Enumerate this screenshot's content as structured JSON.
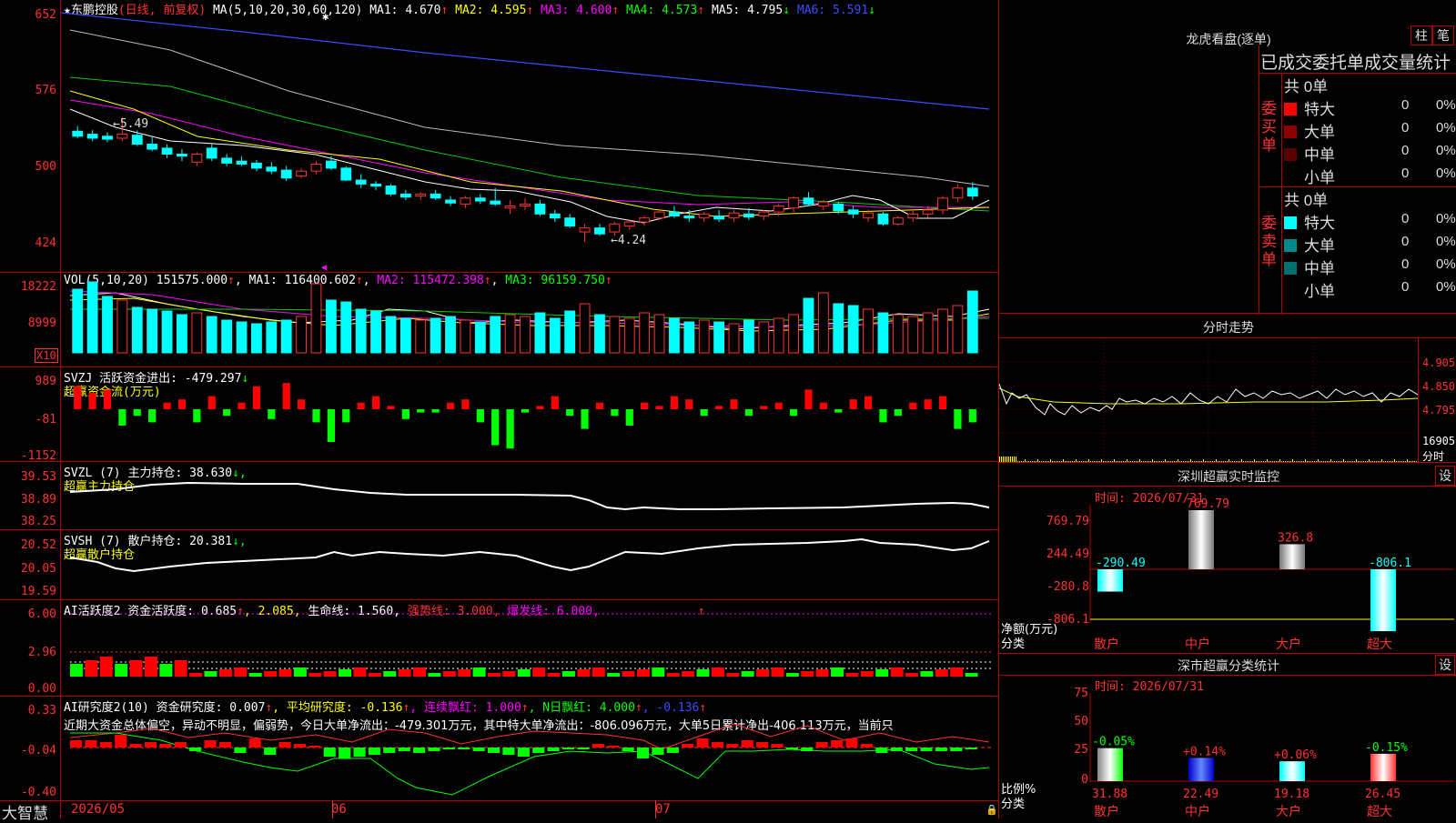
{
  "stock": {
    "star": "★",
    "name": "东鹏控股",
    "mode": "(日线, 前复权)"
  },
  "main_legend": {
    "ma_label": "MA(5,10,20,30,60,120)",
    "ma1": "MA1: 4.670",
    "ma1_arrow": "↑",
    "ma2": "MA2: 4.595",
    "ma2_arrow": "↑",
    "ma3": "MA3: 4.600",
    "ma3_arrow": "↑",
    "ma4": "MA4: 4.573",
    "ma4_arrow": "↑",
    "ma5": "MA5: 4.795",
    "ma5_arrow": "↓",
    "ma6": "MA6: 5.591",
    "ma6_arrow": "↓"
  },
  "main_axis": {
    "ticks": [
      "652",
      "576",
      "500",
      "424"
    ]
  },
  "annotations": {
    "high": "←5.49",
    "low": "←4.24"
  },
  "vol_panel": {
    "label": "VOL(5,10,20)",
    "value": "151575.000",
    "arrow": "↑",
    "ma1": "MA1: 116400.602",
    "ma1_arrow": "↑",
    "ma2": "MA2: 115472.398",
    "ma2_arrow": "↑",
    "ma3": "MA3: 96159.750",
    "ma3_arrow": "↑",
    "ticks": [
      "18222",
      "8999"
    ],
    "unit": "X10"
  },
  "svzj_panel": {
    "line1": "SVZJ  活跃资金进出: -479.297",
    "arrow": "↓",
    "line2": "超赢资金流(万元)",
    "ticks": [
      "989",
      "-81",
      "-1152"
    ]
  },
  "svzl_panel": {
    "line1": "SVZL (7) 主力持仓: 38.630",
    "arrow": "↓,",
    "line2": "超赢主力持仓",
    "ticks": [
      "39.53",
      "38.89",
      "38.25"
    ]
  },
  "svsh_panel": {
    "line1": "SVSH (7) 散户持仓: 20.381",
    "arrow": "↓,",
    "line2": "超赢散户持仓",
    "ticks": [
      "20.52",
      "20.05",
      "19.59"
    ]
  },
  "ai_active_panel": {
    "label": "AI活跃度2 资金活跃度: 0.685",
    "arrow1": "↑",
    "v2": ", 2.085,",
    "life": " 生命线: 1.560,",
    "strong": " 强势线: 3.000,",
    "burst": " 爆发线: 6.000,",
    "arrow2": "↑",
    "ticks": [
      "6.00",
      "2.96",
      "0.00"
    ]
  },
  "ai_research_panel": {
    "label": "AI研究度2(10) 资金研究度: 0.007",
    "arrow1": "↑",
    "avg": ", 平均研究度: -0.136",
    "arrow2": "↑",
    "cont": ", 连续飘红: 1.000",
    "arrow3": "↑",
    "nday": ", N日飘红: 4.000",
    "arrow4": "↑",
    "last": ", -0.136",
    "arrow5": "↑",
    "text": "近期大资金总体偏空，异动不明显，偏弱势，今日大单净流出：-479.301万元，其中特大单净流出：-806.096万元，大单5日累计净出-406.113万元，当前只",
    "ticks": [
      "0.33",
      "-0.04",
      "-0.40"
    ]
  },
  "bottom_bar": {
    "logo": "大智慧",
    "dates": [
      "2026/05",
      "06",
      "07"
    ]
  },
  "right": {
    "dragon_title": "龙虎看盘(逐单)",
    "btn_zhu": "柱",
    "btn_bi": "笔",
    "stats_title": "已成交委托单成交量统计",
    "buy": {
      "side_label": "委买单",
      "count": "共 0单",
      "rows": [
        {
          "label": "特大",
          "num": "0",
          "pct": "0%"
        },
        {
          "label": "大单",
          "num": "0",
          "pct": "0%"
        },
        {
          "label": "中单",
          "num": "0",
          "pct": "0%"
        },
        {
          "label": "小单",
          "num": "0",
          "pct": "0%"
        }
      ]
    },
    "sell": {
      "side_label": "委卖单",
      "count": "共 0单",
      "rows": [
        {
          "label": "特大",
          "num": "0",
          "pct": "0%"
        },
        {
          "label": "大单",
          "num": "0",
          "pct": "0%"
        },
        {
          "label": "中单",
          "num": "0",
          "pct": "0%"
        },
        {
          "label": "小单",
          "num": "0",
          "pct": "0%"
        }
      ]
    },
    "intraday_title": "分时走势",
    "intraday_ticks": [
      "4.905",
      "4.850",
      "4.795",
      "16905",
      "分时"
    ],
    "monitor": {
      "title": "深圳超赢实时监控",
      "btn": "设",
      "time": "时间: 2026/07/31",
      "ylabels": [
        "769.79",
        "244.49",
        "-280.8",
        "-806.1"
      ],
      "values": [
        "-290.49",
        "769.79",
        "326.8",
        "-806.1"
      ],
      "ytitle": "净额(万元)",
      "xtitle": "分类",
      "cats": [
        "散户",
        "中户",
        "大户",
        "超大"
      ]
    },
    "classify": {
      "title": "深市超赢分类统计",
      "btn": "设",
      "time": "时间: 2026/07/31",
      "ylabels": [
        "75",
        "50",
        "25",
        "0"
      ],
      "pct_labels": [
        "-0.05%",
        "+0.14%",
        "+0.06%",
        "-0.15%"
      ],
      "values": [
        "31.88",
        "22.49",
        "19.18",
        "26.45"
      ],
      "ytitle": "比例%",
      "xtitle": "分类",
      "cats": [
        "散户",
        "中户",
        "大户",
        "超大"
      ]
    }
  },
  "chart_data": {
    "type": "candlestick",
    "ylim": [
      424,
      652
    ],
    "candles": [
      [
        5.35,
        5.4,
        5.28,
        5.3
      ],
      [
        5.32,
        5.36,
        5.25,
        5.28
      ],
      [
        5.3,
        5.34,
        5.24,
        5.27
      ],
      [
        5.28,
        5.49,
        5.25,
        5.32
      ],
      [
        5.31,
        5.36,
        5.2,
        5.22
      ],
      [
        5.22,
        5.3,
        5.15,
        5.17
      ],
      [
        5.18,
        5.22,
        5.08,
        5.12
      ],
      [
        5.12,
        5.17,
        5.05,
        5.1
      ],
      [
        5.04,
        5.14,
        5.0,
        5.12
      ],
      [
        5.18,
        5.22,
        5.05,
        5.08
      ],
      [
        5.08,
        5.12,
        5.0,
        5.03
      ],
      [
        5.05,
        5.1,
        5.0,
        5.02
      ],
      [
        5.03,
        5.06,
        4.95,
        4.98
      ],
      [
        4.99,
        5.04,
        4.92,
        4.95
      ],
      [
        4.96,
        5.0,
        4.85,
        4.88
      ],
      [
        4.9,
        4.98,
        4.88,
        4.95
      ],
      [
        4.95,
        5.05,
        4.92,
        5.02
      ],
      [
        5.05,
        5.1,
        4.96,
        4.98
      ],
      [
        4.98,
        5.0,
        4.85,
        4.86
      ],
      [
        4.86,
        4.92,
        4.78,
        4.82
      ],
      [
        4.82,
        4.85,
        4.76,
        4.8
      ],
      [
        4.8,
        4.82,
        4.7,
        4.72
      ],
      [
        4.72,
        4.76,
        4.66,
        4.69
      ],
      [
        4.7,
        4.74,
        4.66,
        4.72
      ],
      [
        4.72,
        4.76,
        4.66,
        4.68
      ],
      [
        4.66,
        4.7,
        4.6,
        4.63
      ],
      [
        4.62,
        4.7,
        4.58,
        4.68
      ],
      [
        4.68,
        4.72,
        4.62,
        4.65
      ],
      [
        4.65,
        4.78,
        4.6,
        4.62
      ],
      [
        4.58,
        4.66,
        4.52,
        4.6
      ],
      [
        4.6,
        4.68,
        4.56,
        4.62
      ],
      [
        4.62,
        4.66,
        4.5,
        4.52
      ],
      [
        4.52,
        4.56,
        4.44,
        4.48
      ],
      [
        4.48,
        4.52,
        4.38,
        4.4
      ],
      [
        4.34,
        4.42,
        4.24,
        4.38
      ],
      [
        4.38,
        4.42,
        4.3,
        4.32
      ],
      [
        4.34,
        4.44,
        4.3,
        4.42
      ],
      [
        4.4,
        4.46,
        4.36,
        4.44
      ],
      [
        4.44,
        4.5,
        4.4,
        4.48
      ],
      [
        4.48,
        4.56,
        4.46,
        4.54
      ],
      [
        4.54,
        4.6,
        4.48,
        4.5
      ],
      [
        4.5,
        4.56,
        4.44,
        4.48
      ],
      [
        4.48,
        4.54,
        4.44,
        4.52
      ],
      [
        4.5,
        4.56,
        4.44,
        4.47
      ],
      [
        4.48,
        4.56,
        4.44,
        4.53
      ],
      [
        4.52,
        4.58,
        4.46,
        4.49
      ],
      [
        4.5,
        4.56,
        4.46,
        4.54
      ],
      [
        4.54,
        4.62,
        4.5,
        4.6
      ],
      [
        4.58,
        4.7,
        4.54,
        4.68
      ],
      [
        4.68,
        4.74,
        4.6,
        4.62
      ],
      [
        4.6,
        4.66,
        4.56,
        4.64
      ],
      [
        4.62,
        4.64,
        4.52,
        4.55
      ],
      [
        4.56,
        4.6,
        4.48,
        4.52
      ],
      [
        4.48,
        4.56,
        4.44,
        4.53
      ],
      [
        4.52,
        4.54,
        4.4,
        4.42
      ],
      [
        4.42,
        4.5,
        4.4,
        4.48
      ],
      [
        4.48,
        4.56,
        4.44,
        4.52
      ],
      [
        4.52,
        4.6,
        4.48,
        4.56
      ],
      [
        4.56,
        4.7,
        4.52,
        4.68
      ],
      [
        4.68,
        4.82,
        4.64,
        4.78
      ],
      [
        4.78,
        4.84,
        4.66,
        4.7
      ]
    ]
  }
}
